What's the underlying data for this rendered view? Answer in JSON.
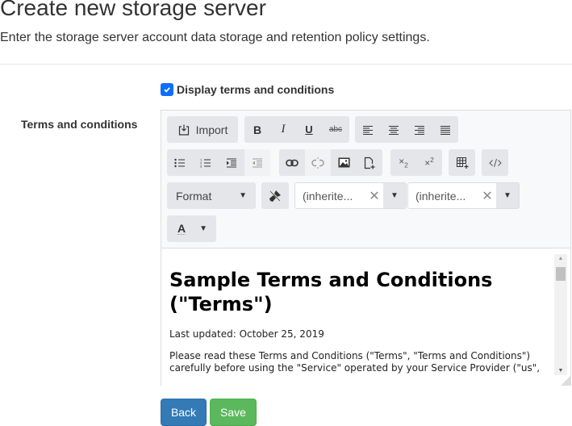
{
  "page": {
    "title": "Create new storage server",
    "subtitle": "Enter the storage server account data storage and retention policy settings."
  },
  "form": {
    "display_terms_checkbox": {
      "label": "Display terms and conditions",
      "checked": true,
      "color": "#0d6efd"
    },
    "terms_label": "Terms and conditions"
  },
  "editor": {
    "toolbar": {
      "import_label": "Import",
      "bold": "B",
      "italic": "I",
      "underline": "U",
      "strikethrough": "abc",
      "format_label": "Format",
      "font_family_value": "(inherite...",
      "font_size_value": "(inherite...",
      "font_color_label": "A",
      "clear_symbol": "✕",
      "dropdown_symbol": "▼",
      "icons": [
        "import-icon",
        "bold-icon",
        "italic-icon",
        "underline-icon",
        "strikethrough-icon",
        "align-left-icon",
        "align-center-icon",
        "align-right-icon",
        "align-justify-icon",
        "bullet-list-icon",
        "numbered-list-icon",
        "indent-icon",
        "outdent-icon",
        "link-icon",
        "unlink-icon",
        "image-icon",
        "insert-file-icon",
        "subscript-icon",
        "superscript-icon",
        "insert-table-icon",
        "view-html-icon",
        "clean-formatting-icon",
        "font-color-icon"
      ]
    },
    "content": {
      "heading": "Sample Terms and Conditions (\"Terms\")",
      "last_updated": "Last updated: October 25, 2019",
      "paragraph": "Please read these Terms and Conditions (\"Terms\", \"Terms and Conditions\") carefully before using the \"Service\" operated by your Service Provider (\"us\","
    }
  },
  "buttons": {
    "back": {
      "label": "Back",
      "color": "#337ab7"
    },
    "save": {
      "label": "Save",
      "color": "#5cb85c"
    }
  }
}
